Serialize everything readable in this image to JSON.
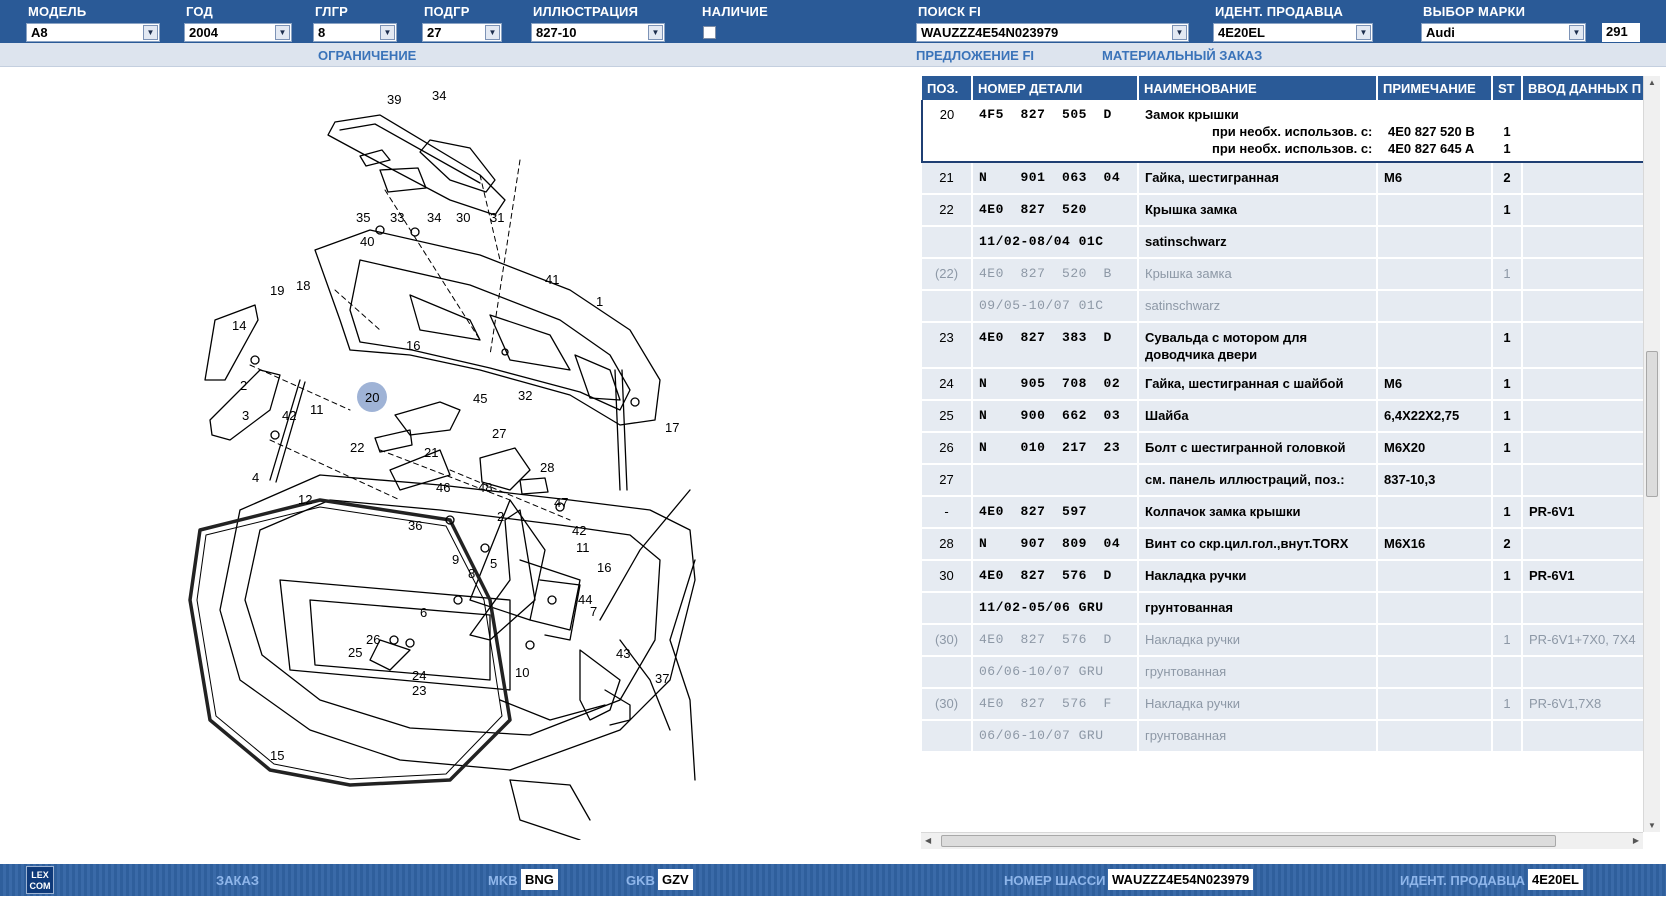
{
  "filters": [
    {
      "label": "МОДЕЛЬ",
      "value": "A8"
    },
    {
      "label": "ГОД",
      "value": "2004"
    },
    {
      "label": "ГЛГР",
      "value": "8"
    },
    {
      "label": "ПОДГР",
      "value": "27"
    },
    {
      "label": "ИЛЛЮСТРАЦИЯ",
      "value": "827-10"
    },
    {
      "label": "НАЛИЧИЕ",
      "value": ""
    },
    {
      "label": "ПОИСК FI",
      "value": "WAUZZZ4E54N023979"
    },
    {
      "label": "ИДЕНТ. ПРОДАВЦА",
      "value": "4E20EL"
    },
    {
      "label": "ВЫБОР МАРКИ",
      "value": "Audi"
    }
  ],
  "page_number": "291",
  "links": {
    "restriction": "ОГРАНИЧЕНИЕ",
    "fi_offer": "ПРЕДЛОЖЕНИЕ FI",
    "material_order": "МАТЕРИАЛЬНЫЙ ЗАКАЗ"
  },
  "diagram": {
    "callouts": [
      "39",
      "34",
      "35",
      "33",
      "34",
      "30",
      "31",
      "40",
      "41",
      "19",
      "18",
      "1",
      "16",
      "14",
      "2",
      "3",
      "42",
      "11",
      "45",
      "32",
      "20",
      "17",
      "22",
      "21",
      "27",
      "28",
      "4",
      "12",
      "46",
      "48",
      "47",
      "36",
      "2",
      "42",
      "11",
      "9",
      "8",
      "5",
      "16",
      "44",
      "6",
      "7",
      "26",
      "25",
      "24",
      "23",
      "43",
      "37",
      "10",
      "15"
    ],
    "highlighted": "20"
  },
  "table": {
    "columns": [
      "ПОЗ.",
      "НОМЕР ДЕТАЛИ",
      "НАИМЕНОВАНИЕ",
      "ПРИМЕЧАНИЕ",
      "ST",
      "ВВОД ДАННЫХ П"
    ],
    "rows": [
      {
        "pos": "20",
        "num": "4F5  827  505  D",
        "name": "Замок крышки",
        "note": "",
        "st": "",
        "ent": "",
        "selected": true,
        "sub": [
          {
            "text": "при необх. использов. с:",
            "note": "4E0 827 520 B",
            "st": "1"
          },
          {
            "text": "при необх. использов. с:",
            "note": "4E0 827 645 A",
            "st": "1"
          }
        ]
      },
      {
        "pos": "21",
        "num": "N    901  063  04",
        "name": "Гайка, шестигранная",
        "note": "M6",
        "st": "2",
        "ent": ""
      },
      {
        "pos": "22",
        "num": "4E0  827  520",
        "name": "Крышка замка",
        "note": "",
        "st": "1",
        "ent": ""
      },
      {
        "pos": "",
        "num": "11/02-08/04 01C",
        "name": "satinschwarz",
        "note": "",
        "st": "",
        "ent": ""
      },
      {
        "pos": "(22)",
        "num": "4E0  827  520  B",
        "name": "Крышка замка",
        "note": "",
        "st": "1",
        "ent": "",
        "grey": true
      },
      {
        "pos": "",
        "num": "09/05-10/07 01C",
        "name": "satinschwarz",
        "note": "",
        "st": "",
        "ent": "",
        "grey": true
      },
      {
        "pos": "23",
        "num": "4E0  827  383  D",
        "name": "Сувальда с мотором для доводчика двери",
        "note": "",
        "st": "1",
        "ent": ""
      },
      {
        "pos": "24",
        "num": "N    905  708  02",
        "name": "Гайка, шестигранная с шайбой",
        "note": "M6",
        "st": "1",
        "ent": ""
      },
      {
        "pos": "25",
        "num": "N    900  662  03",
        "name": "Шайба",
        "note": "6,4X22X2,75",
        "st": "1",
        "ent": ""
      },
      {
        "pos": "26",
        "num": "N    010  217  23",
        "name": "Болт с шестигранной головкой",
        "note": "M6X20",
        "st": "1",
        "ent": ""
      },
      {
        "pos": "27",
        "num": "",
        "name": "см. панель иллюстраций, поз.:",
        "note": "837-10,3",
        "st": "",
        "ent": ""
      },
      {
        "pos": "-",
        "num": "4E0  827  597",
        "name": "Колпачок замка крышки",
        "note": "",
        "st": "1",
        "ent": "PR-6V1"
      },
      {
        "pos": "28",
        "num": "N    907  809  04",
        "name": "Винт со скр.цил.гол.,внут.TORX",
        "note": "M6X16",
        "st": "2",
        "ent": ""
      },
      {
        "pos": "30",
        "num": "4E0  827  576  D",
        "name": "Накладка ручки",
        "note": "",
        "st": "1",
        "ent": "PR-6V1"
      },
      {
        "pos": "",
        "num": "11/02-05/06 GRU",
        "name": "грунтованная",
        "note": "",
        "st": "",
        "ent": ""
      },
      {
        "pos": "(30)",
        "num": "4E0  827  576  D",
        "name": "Накладка ручки",
        "note": "",
        "st": "1",
        "ent": "PR-6V1+7X0, 7X4",
        "grey": true
      },
      {
        "pos": "",
        "num": "06/06-10/07 GRU",
        "name": "грунтованная",
        "note": "",
        "st": "",
        "ent": "",
        "grey": true
      },
      {
        "pos": "(30)",
        "num": "4E0  827  576  F",
        "name": "Накладка ручки",
        "note": "",
        "st": "1",
        "ent": "PR-6V1,7X8",
        "grey": true
      },
      {
        "pos": "",
        "num": "06/06-10/07 GRU",
        "name": "грунтованная",
        "note": "",
        "st": "",
        "ent": "",
        "grey": true
      }
    ]
  },
  "bottom": {
    "logo": "LEX COM",
    "order": "ЗАКАЗ",
    "mkb_label": "MKB",
    "mkb_value": "BNG",
    "gkb_label": "GKB",
    "gkb_value": "GZV",
    "chassis_label": "НОМЕР ШАССИ",
    "chassis_value": "WAUZZZ4E54N023979",
    "dealer_label": "ИДЕНТ. ПРОДАВЦА",
    "dealer_value": "4E20EL"
  }
}
